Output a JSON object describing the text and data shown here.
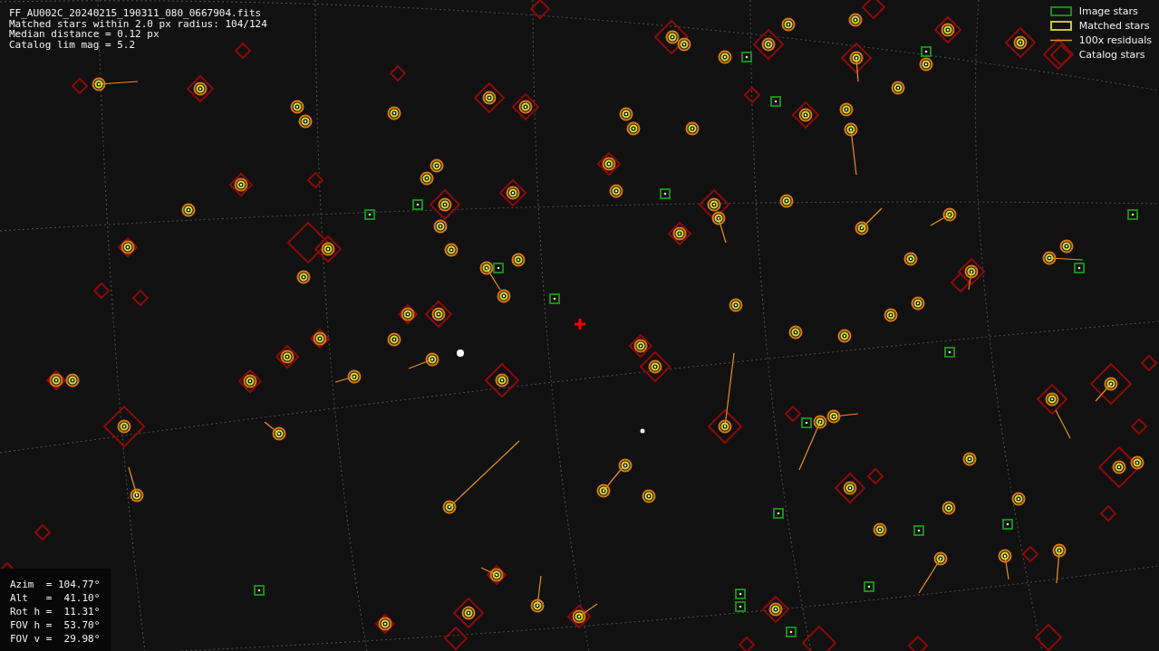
{
  "file_info": [
    "FF_AU002C_20240215_190311_080_0667904.fits",
    "Matched stars within 2.0 px radius: 104/124",
    "Median distance = 0.12 px",
    "Catalog lim mag = 5.2"
  ],
  "legend": [
    {
      "kind": "image",
      "label": "Image stars"
    },
    {
      "kind": "matched",
      "label": "Matched stars"
    },
    {
      "kind": "residual",
      "label": "100x residuals"
    },
    {
      "kind": "catalog",
      "label": "Catalog stars"
    }
  ],
  "pointing": [
    "Azim  = 104.77°",
    "Alt   =  41.10°",
    "Rot h =  11.31°",
    "FOV h =  53.70°",
    "FOV v =  29.98°"
  ]
}
